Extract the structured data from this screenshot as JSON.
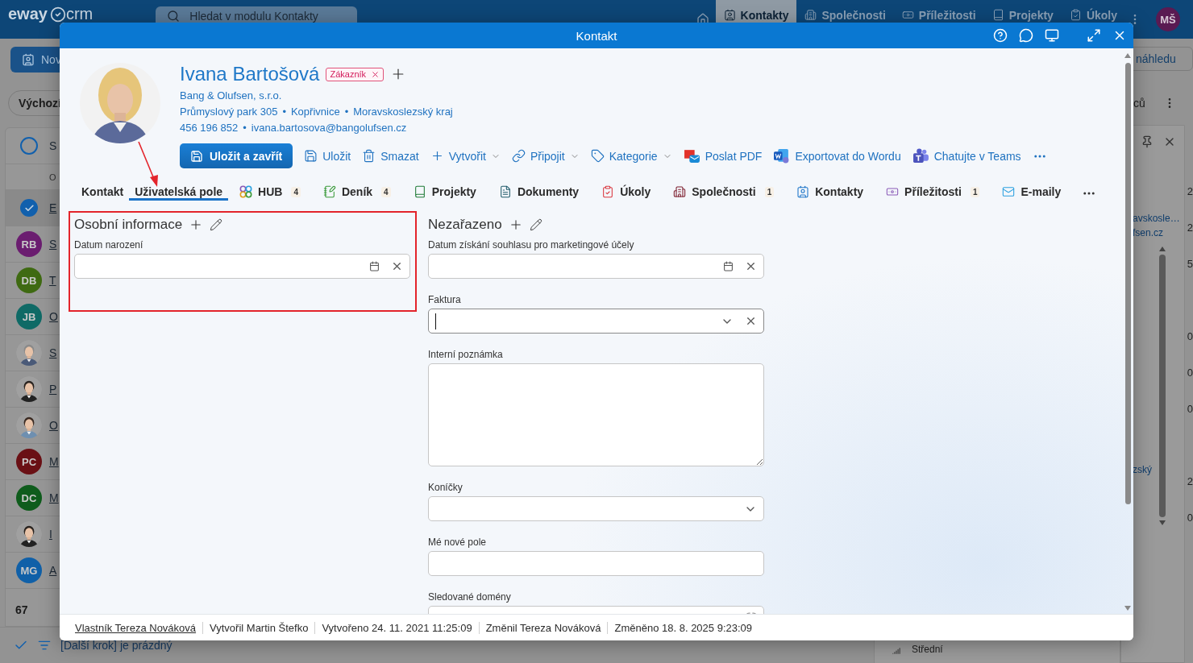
{
  "topbar": {
    "logo": "eway",
    "logo_suffix": "crm",
    "search_placeholder": "Hledat v modulu Kontakty",
    "nav": [
      {
        "label": "Kontakty",
        "kind": "card",
        "selected": true
      },
      {
        "label": "Společnosti",
        "kind": "building",
        "selected": false
      },
      {
        "label": "Příležitosti",
        "kind": "money",
        "selected": false
      },
      {
        "label": "Projekty",
        "kind": "book",
        "selected": false
      },
      {
        "label": "Úkoly",
        "kind": "clipboard",
        "selected": false
      }
    ],
    "user_initials": "MŠ"
  },
  "list": {
    "new_button": "Nov",
    "view": "Výchozí",
    "all_selected": false,
    "header_letter": "S",
    "column_letter": "O",
    "rows": [
      {
        "kind": "check",
        "selected": true,
        "letter": "E",
        "number": "2"
      },
      {
        "kind": "initials",
        "initials": "RB",
        "color": "#6b1d70",
        "letter": "S",
        "number": "2"
      },
      {
        "kind": "initials",
        "initials": "DB",
        "color": "#3f6a12",
        "letter": "T",
        "number": "5"
      },
      {
        "kind": "initials",
        "initials": "JB",
        "color": "#0f6a66",
        "letter": "O"
      },
      {
        "letter": "S",
        "number": "0"
      },
      {
        "letter": "P",
        "number": "0"
      },
      {
        "letter": "O",
        "number": "0"
      },
      {
        "kind": "initials",
        "initials": "PC",
        "color": "#6a1015",
        "letter": "M"
      },
      {
        "kind": "initials",
        "initials": "DC",
        "color": "#0f5c1c",
        "letter": "M",
        "number": "2"
      },
      {
        "letter": "I",
        "number": "0"
      },
      {
        "kind": "initials",
        "initials": "MG",
        "color": "#1060a8",
        "letter": "A"
      }
    ],
    "count": "67",
    "next_step": "[Další krok] je prázdný"
  },
  "preview": {
    "button": "náhledu",
    "label": "ců",
    "links": [
      "avskosle…",
      "fsen.cz"
    ],
    "region": "zský",
    "priority": "Střední"
  },
  "dialog": {
    "title": "Kontakt",
    "contact": {
      "name": "Ivana Bartošová",
      "tag": "Zákazník",
      "company": "Bang & Olufsen, s.r.o.",
      "separator": "•",
      "address": [
        "Průmyslový park 305",
        "Kopřivnice",
        "Moravskoslezský kraj"
      ],
      "reach": [
        "456 196 852",
        "ivana.bartosova@bangolufsen.cz"
      ]
    },
    "toolbar": {
      "primary": "Uložit a zavřít",
      "actions": [
        {
          "label": "Uložit",
          "kind": "save",
          "dropdown": false
        },
        {
          "label": "Smazat",
          "kind": "delete",
          "dropdown": false
        },
        {
          "label": "Vytvořit",
          "kind": "plus",
          "dropdown": true
        },
        {
          "label": "Připojit",
          "kind": "link",
          "dropdown": true
        },
        {
          "label": "Kategorie",
          "kind": "tag",
          "dropdown": true
        },
        {
          "label": "Poslat PDF",
          "kind": "pdf",
          "dropdown": false
        },
        {
          "label": "Exportovat do Wordu",
          "kind": "word",
          "dropdown": false
        },
        {
          "label": "Chatujte v Teams",
          "kind": "teams",
          "dropdown": false
        }
      ]
    },
    "tabs": [
      {
        "label": "Kontakt",
        "kind": "plain",
        "selected": false,
        "annotated": false
      },
      {
        "label": "Uživatelská pole",
        "kind": "plain",
        "selected": true,
        "annotated": true
      },
      {
        "label": "HUB",
        "kind": "hub",
        "count": "4",
        "selected": false,
        "annotated": false
      },
      {
        "label": "Deník",
        "kind": "journal",
        "count": "4",
        "selected": false,
        "annotated": false
      },
      {
        "label": "Projekty",
        "kind": "book",
        "selected": false,
        "annotated": false
      },
      {
        "label": "Dokumenty",
        "kind": "document",
        "selected": false,
        "annotated": false
      },
      {
        "label": "Úkoly",
        "kind": "clipboard",
        "selected": false,
        "annotated": false
      },
      {
        "label": "Společnosti",
        "kind": "building",
        "count": "1",
        "selected": false,
        "annotated": false
      },
      {
        "label": "Kontakty",
        "kind": "card",
        "selected": false,
        "annotated": false
      },
      {
        "label": "Příležitosti",
        "kind": "money",
        "count": "1",
        "selected": false,
        "annotated": false
      },
      {
        "label": "E-maily",
        "kind": "mail",
        "selected": false,
        "annotated": false
      }
    ],
    "sections": [
      {
        "title": "Osobní informace",
        "highlighted": true,
        "fields": [
          {
            "label": "Datum narození",
            "kind": "date",
            "focused": false
          }
        ]
      },
      {
        "title": "Nezařazeno",
        "highlighted": false,
        "fields": [
          {
            "label": "Datum získání souhlasu pro marketingové účely",
            "kind": "date",
            "focused": false
          },
          {
            "label": "Faktura",
            "kind": "lookup",
            "focused": true
          },
          {
            "label": "Interní poznámka",
            "kind": "textarea",
            "focused": false
          },
          {
            "label": "Koníčky",
            "kind": "select",
            "focused": false
          },
          {
            "label": "Mé nové pole",
            "kind": "text",
            "focused": false
          },
          {
            "label": "Sledované domény",
            "kind": "url",
            "focused": false
          }
        ]
      }
    ],
    "footer": [
      {
        "text": "Vlastník Tereza Nováková",
        "link": true
      },
      {
        "text": "Vytvořil Martin Štefko",
        "link": false
      },
      {
        "text": "Vytvořeno 24. 11. 2021 11:25:09",
        "link": false
      },
      {
        "text": "Změnil Tereza Nováková",
        "link": false
      },
      {
        "text": "Změněno 18. 8. 2025 9:23:09",
        "link": false
      }
    ]
  }
}
